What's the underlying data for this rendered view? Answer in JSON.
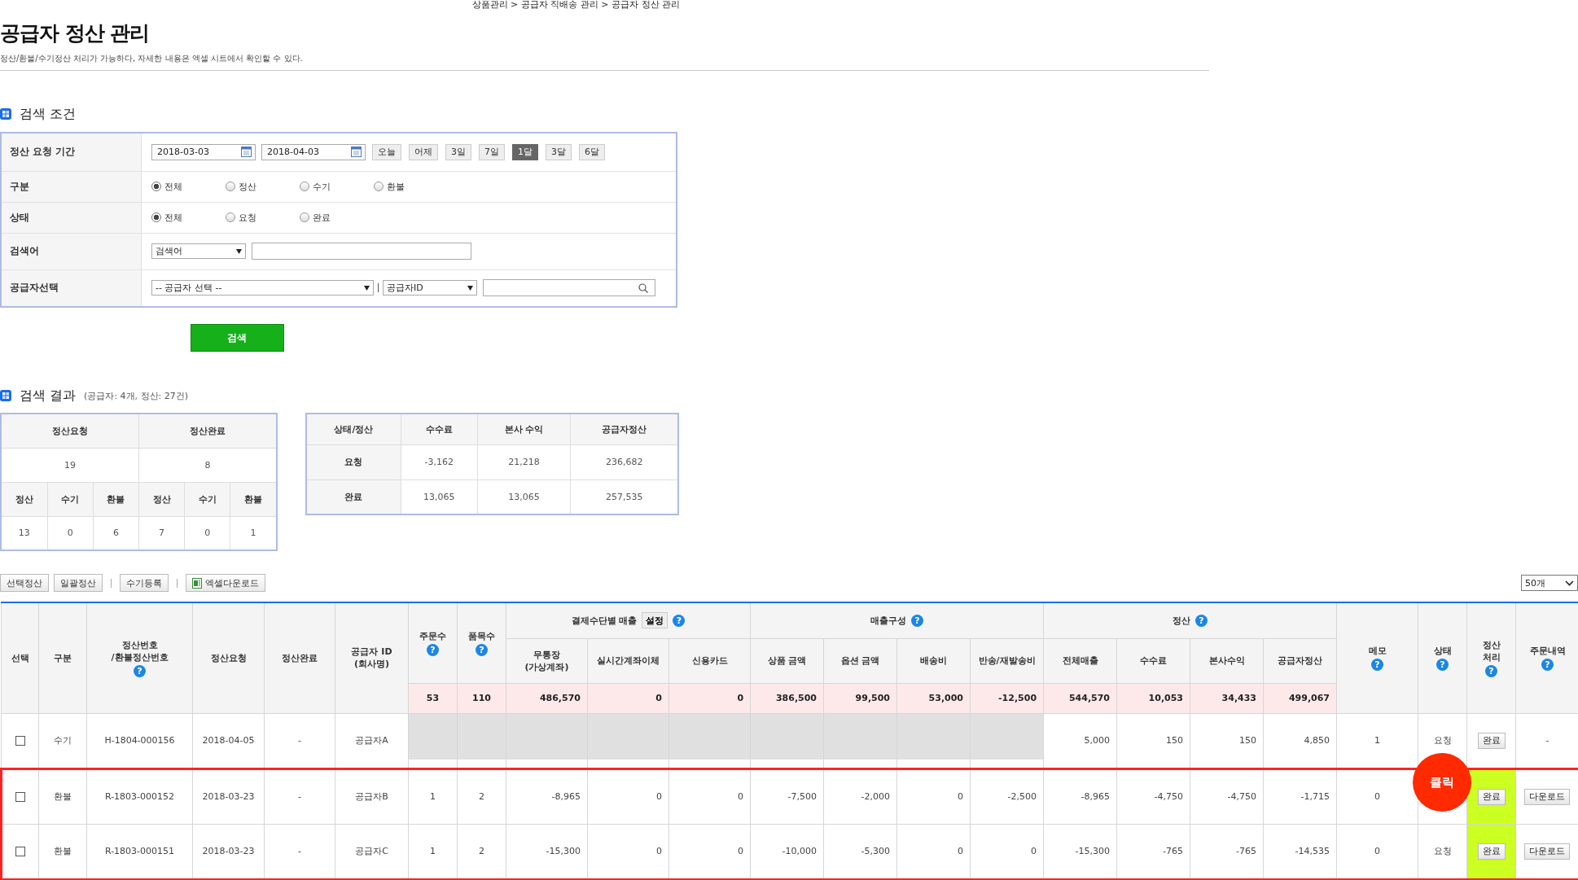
{
  "breadcrumb": "상품관리 > 공급자 직배송 관리 > 공급자 정산 관리",
  "title": "공급자 정산 관리",
  "description": "정산/환불/수기정산 처리가 가능하다, 자세한 내용은 엑셀 시트에서 확인할 수 있다.",
  "search": {
    "title": "검색 조건",
    "rows": [
      {
        "kind": "period",
        "label": "정산 요청 기간",
        "from": "2018-03-03",
        "to": "2018-04-03",
        "presets": [
          {
            "label": "오늘",
            "selected": false
          },
          {
            "label": "어제",
            "selected": false
          },
          {
            "label": "3일",
            "selected": false
          },
          {
            "label": "7일",
            "selected": false
          },
          {
            "label": "1달",
            "selected": true
          },
          {
            "label": "3달",
            "selected": false
          },
          {
            "label": "6달",
            "selected": false
          }
        ]
      },
      {
        "kind": "radio",
        "label": "구분",
        "options": [
          {
            "label": "전체",
            "selected": true
          },
          {
            "label": "정산",
            "selected": false
          },
          {
            "label": "수기",
            "selected": false
          },
          {
            "label": "환불",
            "selected": false
          }
        ]
      },
      {
        "kind": "radio",
        "label": "상태",
        "options": [
          {
            "label": "전체",
            "selected": true
          },
          {
            "label": "요청",
            "selected": false
          },
          {
            "label": "완료",
            "selected": false
          }
        ]
      },
      {
        "kind": "keyword",
        "label": "검색어",
        "select": "검색어"
      },
      {
        "kind": "supplier",
        "label": "공급자선택",
        "select": "-- 공급자 선택 --",
        "id_select": "공급자ID"
      }
    ],
    "button": "검색"
  },
  "results": {
    "title": "검색 결과",
    "note": "(공급자: 4개, 정산: 27건)",
    "count_summary": [
      {
        "label": "정산요청",
        "count": "19",
        "breakdown": [
          {
            "label": "정산",
            "value": "13"
          },
          {
            "label": "수기",
            "value": "0"
          },
          {
            "label": "환불",
            "value": "6"
          }
        ]
      },
      {
        "label": "정산완료",
        "count": "8",
        "breakdown": [
          {
            "label": "정산",
            "value": "7"
          },
          {
            "label": "수기",
            "value": "0"
          },
          {
            "label": "환불",
            "value": "1"
          }
        ]
      }
    ],
    "amount_summary": {
      "columns": [
        "상태/정산",
        "수수료",
        "본사 수익",
        "공급자정산"
      ],
      "rows": [
        [
          "요청",
          "-3,162",
          "21,218",
          "236,682"
        ],
        [
          "완료",
          "13,065",
          "13,065",
          "257,535"
        ]
      ]
    }
  },
  "toolbar": [
    {
      "kind": "button",
      "label": "선택정산"
    },
    {
      "kind": "button",
      "label": "일괄정산"
    },
    {
      "kind": "divider"
    },
    {
      "kind": "button",
      "label": "수기등록"
    },
    {
      "kind": "divider"
    },
    {
      "kind": "excel",
      "label": "엑셀다운로드"
    }
  ],
  "page_size": "50개",
  "table": {
    "columns": [
      {
        "label": "선택"
      },
      {
        "label": "구분"
      },
      {
        "label": "정산번호\n/환불정산번호",
        "help": "?"
      },
      {
        "label": "정산요청"
      },
      {
        "label": "정산완료"
      },
      {
        "label": "공급자 ID\n(회사명)"
      },
      {
        "label": "주문수",
        "help": "?",
        "total": "53"
      },
      {
        "label": "품목수",
        "help": "?",
        "total": "110"
      },
      {
        "label": "결제수단별 매출",
        "button": "설정",
        "help": "?",
        "children": [
          {
            "label": "무통장\n(가상계좌)",
            "total": "486,570"
          },
          {
            "label": "실시간계좌이체",
            "total": "0"
          },
          {
            "label": "신용카드",
            "total": "0"
          }
        ]
      },
      {
        "label": "매출구성",
        "help": "?",
        "children": [
          {
            "label": "상품 금액",
            "total": "386,500"
          },
          {
            "label": "옵션 금액",
            "total": "99,500"
          },
          {
            "label": "배송비",
            "total": "53,000"
          },
          {
            "label": "반송/재발송비",
            "total": "-12,500"
          }
        ]
      },
      {
        "label": "정산",
        "help": "?",
        "children": [
          {
            "label": "전체매출",
            "total": "544,570"
          },
          {
            "label": "수수료",
            "total": "10,053"
          },
          {
            "label": "본사수익",
            "total": "34,433"
          },
          {
            "label": "공급자정산",
            "total": "499,067"
          }
        ]
      },
      {
        "label": "메모",
        "help": "?"
      },
      {
        "label": "상태",
        "help": "?"
      },
      {
        "label": "정산\n처리",
        "help": "?"
      },
      {
        "label": "주문내역",
        "help": "?"
      }
    ],
    "rows": [
      {
        "kind": "manual",
        "checked": false,
        "highlighted": false,
        "type": "수기",
        "number": "H-1804-000156",
        "requested": "2018-04-05",
        "completed": "-",
        "supplier": "공급자A",
        "settlement": [
          "5,000",
          "150",
          "150",
          "4,850"
        ],
        "memo": "1",
        "status": "요청",
        "action": "완료",
        "detail": {
          "kind": "text",
          "label": "-"
        }
      },
      {
        "kind": "refund",
        "checked": false,
        "highlighted": true,
        "type": "환불",
        "number": "R-1803-000152",
        "requested": "2018-03-23",
        "completed": "-",
        "supplier": "공급자B",
        "orders": "1",
        "items": "2",
        "payment": [
          "-8,965",
          "0",
          "0"
        ],
        "sales": [
          "-7,500",
          "-2,000",
          "0",
          "-2,500"
        ],
        "settlement": [
          "-8,965",
          "-4,750",
          "-4,750",
          "-1,715"
        ],
        "memo": "0",
        "action": "완료",
        "detail": {
          "kind": "button",
          "label": "다운로드"
        }
      },
      {
        "kind": "refund",
        "checked": false,
        "highlighted": true,
        "type": "환불",
        "number": "R-1803-000151",
        "requested": "2018-03-23",
        "completed": "-",
        "supplier": "공급자C",
        "orders": "1",
        "items": "2",
        "payment": [
          "-15,300",
          "0",
          "0"
        ],
        "sales": [
          "-10,000",
          "-5,300",
          "0",
          "0"
        ],
        "settlement": [
          "-15,300",
          "-765",
          "-765",
          "-14,535"
        ],
        "memo": "0",
        "status": "요청",
        "action": "완료",
        "detail": {
          "kind": "button",
          "label": "다운로드"
        }
      }
    ]
  },
  "callout": {
    "text": "클릭"
  }
}
